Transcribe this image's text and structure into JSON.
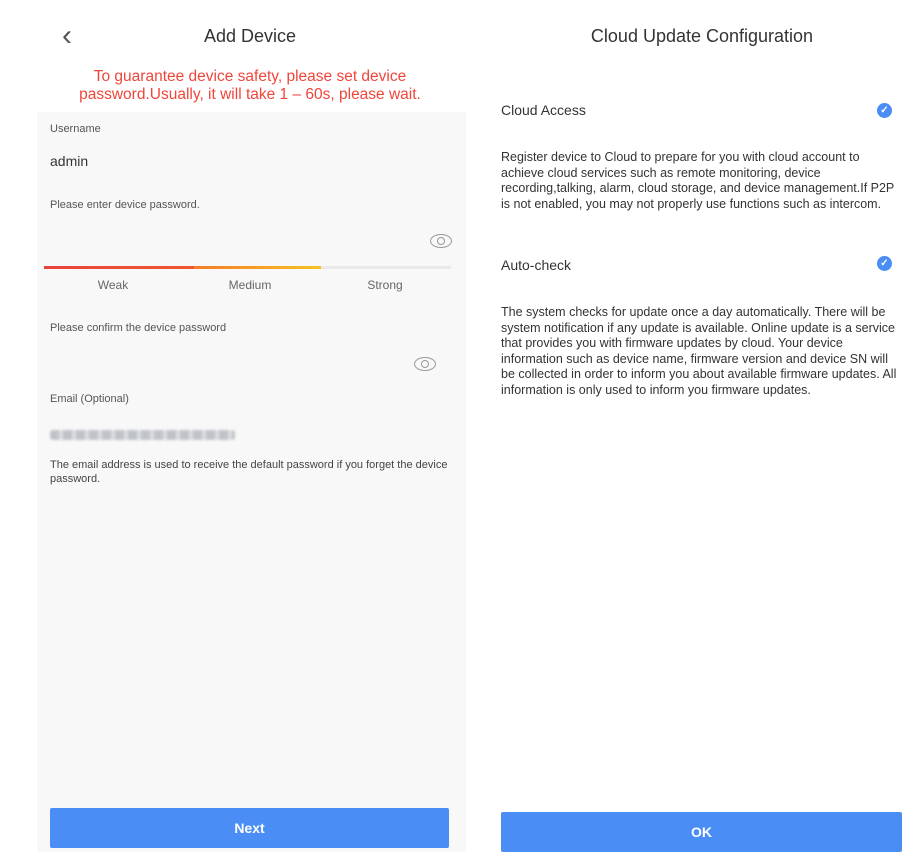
{
  "left": {
    "title": "Add Device",
    "warning": "To guarantee device safety, please set device password.Usually, it will take 1 – 60s, please wait.",
    "username_label": "Username",
    "username_value": "admin",
    "password_label": "Please enter device password.",
    "strength": [
      "Weak",
      "Medium",
      "Strong"
    ],
    "confirm_label": "Please confirm the device password",
    "email_label": "Email (Optional)",
    "email_hint": "The email address is used to receive the default password if you forget the device password.",
    "next_label": "Next"
  },
  "right": {
    "title": "Cloud Update Configuration",
    "cloud_access_label": "Cloud Access",
    "cloud_access_checked": true,
    "cloud_access_desc": "Register device to Cloud to prepare for you with cloud account to achieve cloud services such as remote monitoring, device recording,talking, alarm, cloud storage, and device management.If P2P is not enabled, you may not properly use functions such as intercom.",
    "auto_check_label": "Auto-check",
    "auto_check_checked": true,
    "auto_check_desc": "The system checks for update once a day automatically. There will be system notification if any update is available. Online update is a service that provides you with firmware updates by cloud. Your device information such as device name, firmware version and device SN will be collected in order to inform you about available firmware updates. All information is only used to inform you firmware updates.",
    "ok_label": "OK"
  },
  "colors": {
    "accent": "#4a8ef5",
    "warning": "#f0453a"
  }
}
